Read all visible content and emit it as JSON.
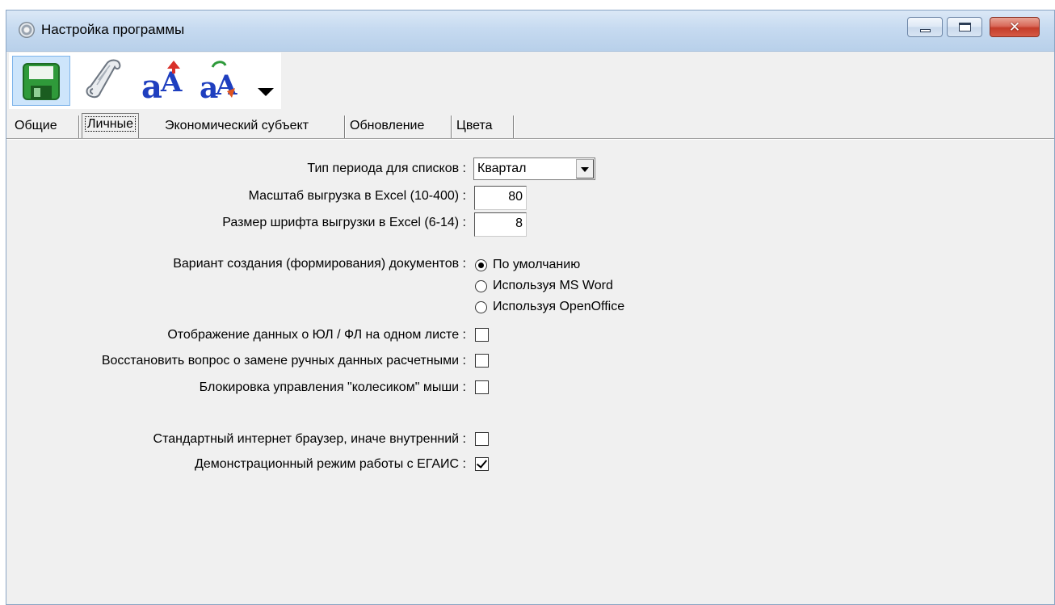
{
  "window": {
    "title": "Настройка программы"
  },
  "tabs": [
    "Общие",
    "Личные",
    "Экономический субъект",
    "Обновление",
    "Цвета"
  ],
  "active_tab": "Личные",
  "settings": {
    "period_label": "Тип периода для списков :",
    "period_value": "Квартал",
    "excel_scale_label": "Масштаб выгрузка в Excel (10-400) :",
    "excel_scale_value": "80",
    "excel_font_label": "Размер шрифта выгрузки в Excel (6-14) :",
    "excel_font_value": "8",
    "doc_variant_label": "Вариант создания (формирования) документов :",
    "doc_variant_options": [
      "По умолчанию",
      "Используя MS Word",
      "Используя OpenOffice"
    ],
    "doc_variant_selected": 0,
    "show_ul_fl_label": "Отображение данных о ЮЛ / ФЛ на одном листе :",
    "show_ul_fl_checked": false,
    "restore_question_label": "Восстановить вопрос о замене ручных данных расчетными :",
    "restore_question_checked": false,
    "wheel_lock_label": "Блокировка управления \"колесиком\" мыши :",
    "wheel_lock_checked": false,
    "std_browser_label": "Стандартный интернет браузер, иначе внутренний :",
    "std_browser_checked": false,
    "egais_demo_label": "Демонстрационный режим работы с ЕГАИС :",
    "egais_demo_checked": true
  },
  "toolbar": {
    "icons": [
      "save-icon",
      "script-icon",
      "font-increase-icon",
      "font-decrease-icon",
      "dropdown-arrow-icon"
    ]
  },
  "colors": {
    "title_bg": "#c6daf0",
    "panel_bg": "#f0f0f0",
    "close_btn": "#c43d2a",
    "save_highlight": "#cde5fb"
  }
}
